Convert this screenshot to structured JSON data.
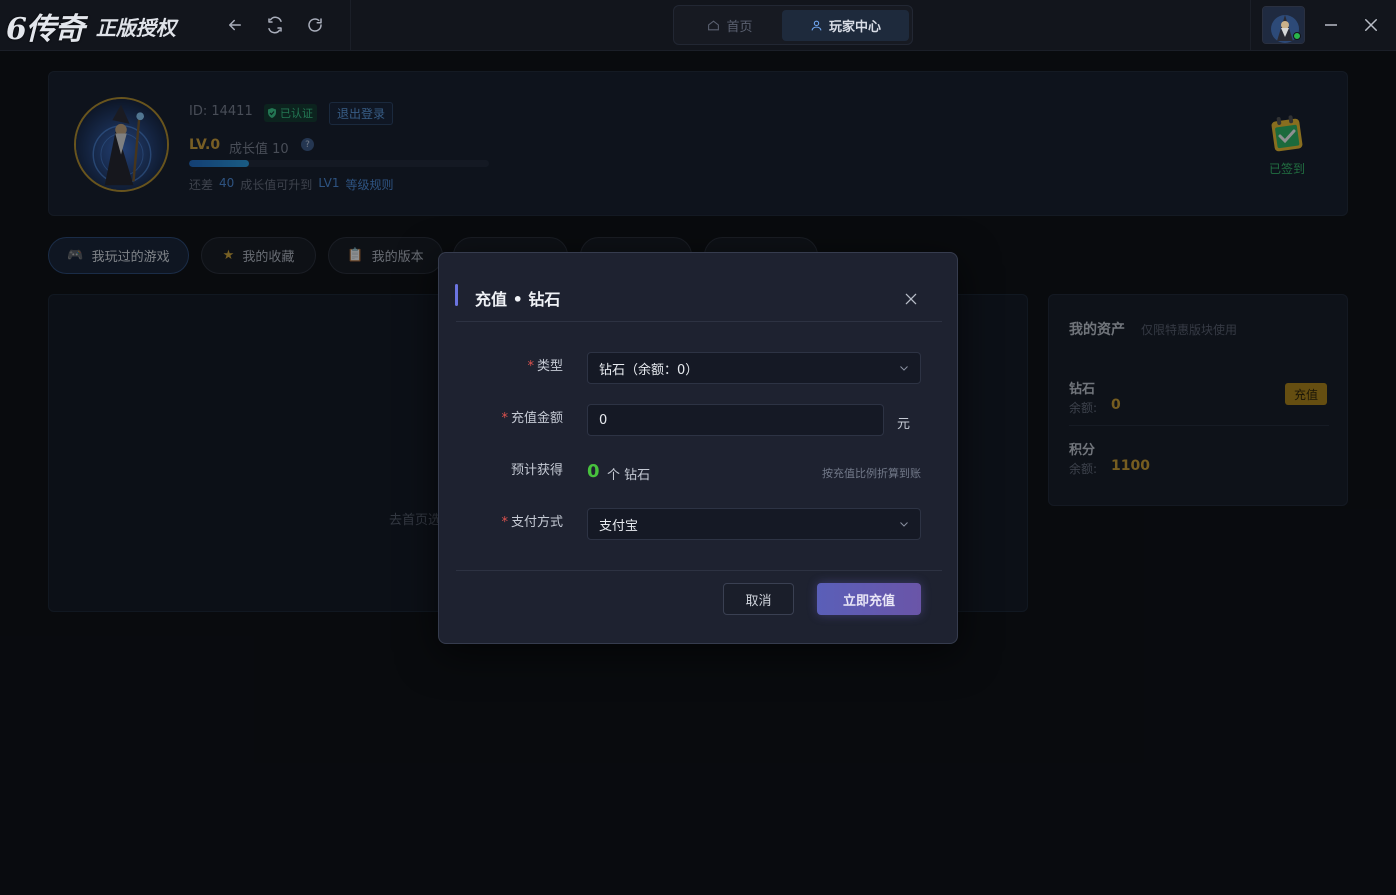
{
  "titlebar": {
    "logo_main": "6传奇",
    "logo_sub": "正版授权",
    "tabs": [
      {
        "label": "首页",
        "icon": "home-icon"
      },
      {
        "label": "玩家中心",
        "icon": "user-icon"
      }
    ]
  },
  "profile": {
    "id_text": "ID: 14411",
    "verified": "已认证",
    "logout": "退出登录",
    "level": "LV.0",
    "growth_label": "成长值 10",
    "help": "?",
    "progress": 0.2,
    "upgrade_prefix": "还差",
    "upgrade_amount": "40",
    "upgrade_mid": "成长值可升到",
    "upgrade_target": "LV1",
    "level_rules": "等级规则",
    "signed_in": "已签到"
  },
  "tabs": [
    {
      "label": "我玩过的游戏",
      "icon": "🎮",
      "icon_name": "gamepad-icon"
    },
    {
      "label": "我的收藏",
      "icon": "★",
      "icon_name": "star-icon"
    },
    {
      "label": "我的版本",
      "icon": "📋",
      "icon_name": "clipboard-icon"
    }
  ],
  "content": {
    "empty_text": "去首页选"
  },
  "assets": {
    "title": "我的资产",
    "subtitle": "仅限特惠版块使用",
    "diamond_name": "钻石",
    "balance_label": "余额:",
    "diamond_balance": "0",
    "recharge": "充值",
    "points_name": "积分",
    "points_balance": "1100"
  },
  "modal": {
    "title": "充值 • 钻石",
    "type_label": "类型",
    "type_value": "钻石（余额：0）",
    "amount_label": "充值金额",
    "amount_value": "0",
    "amount_unit": "元",
    "estimate_label": "预计获得",
    "estimate_value": "0",
    "estimate_unit": "个 钻石",
    "estimate_hint": "按充值比例折算到账",
    "pay_label": "支付方式",
    "pay_value": "支付宝",
    "cancel": "取消",
    "submit": "立即充值"
  },
  "colors": {
    "accent_gold": "#d2a332",
    "accent_blue": "#4d8fe0",
    "accent_green": "#47c23d",
    "modal_button": "#5a5fb8"
  }
}
